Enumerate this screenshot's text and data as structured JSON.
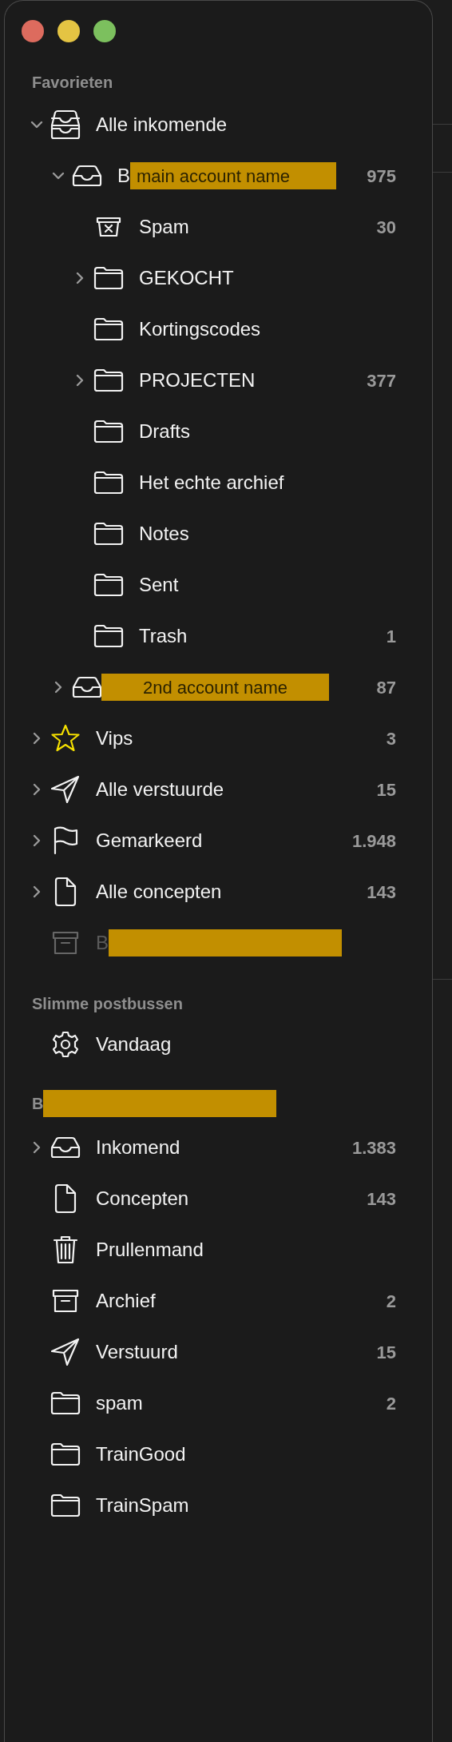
{
  "window": {
    "controls": [
      {
        "color": "#dd6b5e"
      },
      {
        "color": "#e4c443"
      },
      {
        "color": "#7cc05e"
      }
    ]
  },
  "sections": [
    {
      "header": "Favorieten",
      "items": [
        {
          "kind": "all-inbox",
          "label": "Alle inkomende",
          "expanded": true,
          "disabled": false,
          "children": [
            {
              "kind": "inbox",
              "label": "B",
              "redaction": "main account name",
              "count": "975",
              "expanded": true,
              "children": [
                {
                  "kind": "junk",
                  "label": "Spam",
                  "count": "30"
                },
                {
                  "kind": "folder",
                  "label": "GEKOCHT",
                  "expanded": false
                },
                {
                  "kind": "folder",
                  "label": "Kortingscodes"
                },
                {
                  "kind": "folder",
                  "label": "PROJECTEN",
                  "count": "377",
                  "expanded": false
                },
                {
                  "kind": "folder",
                  "label": "Drafts"
                },
                {
                  "kind": "folder",
                  "label": "Het echte archief"
                },
                {
                  "kind": "folder",
                  "label": "Notes"
                },
                {
                  "kind": "folder",
                  "label": "Sent"
                },
                {
                  "kind": "folder",
                  "label": "Trash",
                  "count": "1"
                }
              ]
            },
            {
              "kind": "inbox",
              "redaction": "2nd account name",
              "count": "87",
              "expanded": false
            }
          ]
        },
        {
          "kind": "vip",
          "label": "Vips",
          "count": "3",
          "expanded": false,
          "disabled": false
        },
        {
          "kind": "sent",
          "label": "Alle verstuurde",
          "count": "15",
          "expanded": false,
          "disabled": false
        },
        {
          "kind": "flagged",
          "label": "Gemarkeerd",
          "count": "1.948",
          "expanded": false,
          "disabled": false
        },
        {
          "kind": "drafts",
          "label": "Alle concepten",
          "count": "143",
          "expanded": false,
          "disabled": false
        },
        {
          "kind": "archive",
          "label": "B",
          "redacted": true,
          "disabled": true
        }
      ]
    },
    {
      "header": "Slimme postbussen",
      "items": [
        {
          "kind": "smart",
          "label": "Vandaag"
        }
      ]
    },
    {
      "header": "B",
      "header_redacted": true,
      "items": [
        {
          "kind": "inbox",
          "label": "Inkomend",
          "count": "1.383",
          "expanded": false
        },
        {
          "kind": "drafts",
          "label": "Concepten",
          "count": "143"
        },
        {
          "kind": "trash",
          "label": "Prullenmand"
        },
        {
          "kind": "archive",
          "label": "Archief",
          "count": "2"
        },
        {
          "kind": "sent",
          "label": "Verstuurd",
          "count": "15"
        },
        {
          "kind": "folder",
          "label": "spam",
          "count": "2"
        },
        {
          "kind": "folder",
          "label": "TrainGood"
        },
        {
          "kind": "folder",
          "label": "TrainSpam"
        }
      ]
    }
  ]
}
